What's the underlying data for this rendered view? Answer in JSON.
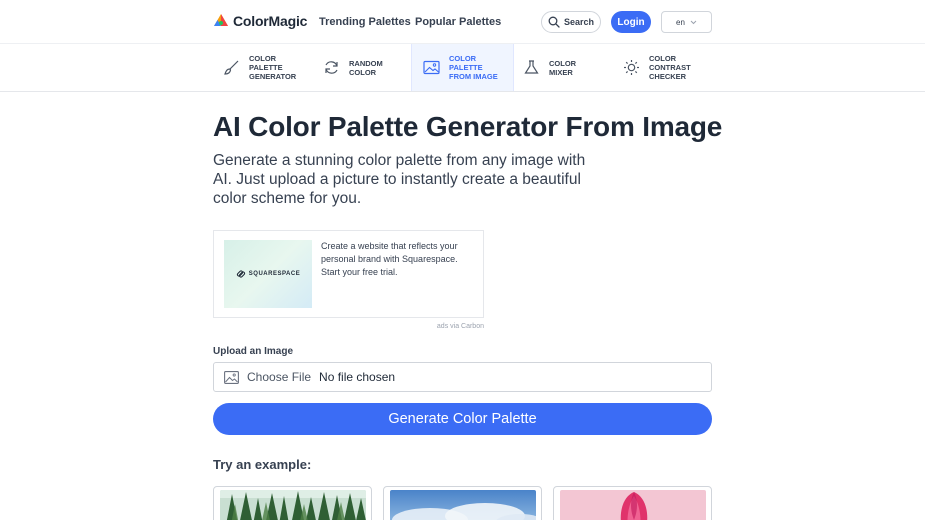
{
  "header": {
    "brand": "ColorMagic",
    "nav": [
      "Trending Palettes",
      "Popular Palettes"
    ],
    "search_label": "Search",
    "login_label": "Login",
    "language": "en"
  },
  "tools": [
    {
      "label": "Color Palette Generator",
      "icon": "brush-icon",
      "active": false
    },
    {
      "label": "Random Color",
      "icon": "refresh-icon",
      "active": false
    },
    {
      "label": "Color Palette from Image",
      "icon": "image-icon",
      "active": true
    },
    {
      "label": "Color Mixer",
      "icon": "flask-icon",
      "active": false
    },
    {
      "label": "Color Contrast Checker",
      "icon": "sun-icon",
      "active": false
    }
  ],
  "main": {
    "title": "AI Color Palette Generator From Image",
    "description": "Generate a stunning color palette from any image with AI. Just upload a picture to instantly create a beautiful color scheme for you."
  },
  "ad": {
    "brand": "SQUARESPACE",
    "text": "Create a website that reflects your personal brand with Squarespace. Start your free trial.",
    "via": "ads via Carbon"
  },
  "upload": {
    "label": "Upload an Image",
    "choose_file": "Choose File",
    "no_file": "No file chosen"
  },
  "generate_label": "Generate Color Palette",
  "examples": {
    "title": "Try an example:",
    "items": [
      {
        "icon": "forest-image-icon"
      },
      {
        "icon": "sky-image-icon"
      },
      {
        "icon": "tulip-image-icon"
      }
    ]
  },
  "colors": {
    "accent": "#3b6cf5",
    "text": "#1f2937",
    "active_bg": "#f0f5ff"
  }
}
